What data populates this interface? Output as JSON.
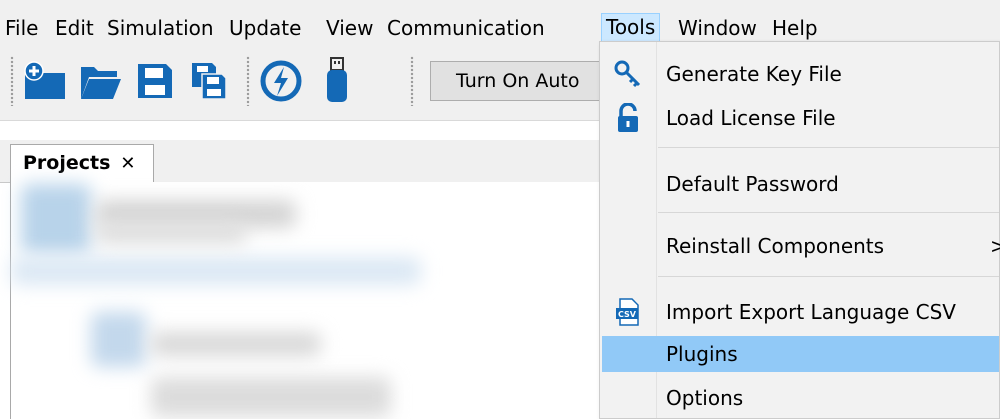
{
  "menubar": {
    "items": [
      "File",
      "Edit",
      "Simulation",
      "Update",
      "View",
      "Communication",
      "Tools",
      "Window",
      "Help"
    ],
    "active": "Tools"
  },
  "toolbar": {
    "buttons": [
      "new-project-icon",
      "open-folder-icon",
      "save-icon",
      "save-all-icon",
      "connect-icon",
      "usb-icon"
    ],
    "auto_button_label": "Turn On Auto"
  },
  "projects": {
    "tab_label": "Projects",
    "close_glyph": "✕"
  },
  "tools_menu": {
    "items": [
      {
        "label": "Generate Key File",
        "icon": "key-icon"
      },
      {
        "label": "Load License File",
        "icon": "unlock-icon"
      },
      {
        "label": "Default Password",
        "icon": ""
      },
      {
        "label": "Reinstall Components",
        "icon": "",
        "submenu_glyph": ">"
      },
      {
        "label": "Import Export Language CSV",
        "icon": "csv-file-icon"
      },
      {
        "label": "Plugins",
        "icon": "",
        "highlighted": true
      },
      {
        "label": "Options",
        "icon": ""
      }
    ]
  },
  "colors": {
    "menubar_bg": "#f0f0f0",
    "menu_highlight": "#91c9f7",
    "active_menu_bg": "#cce8ff",
    "icon_blue": "#1469b6"
  }
}
